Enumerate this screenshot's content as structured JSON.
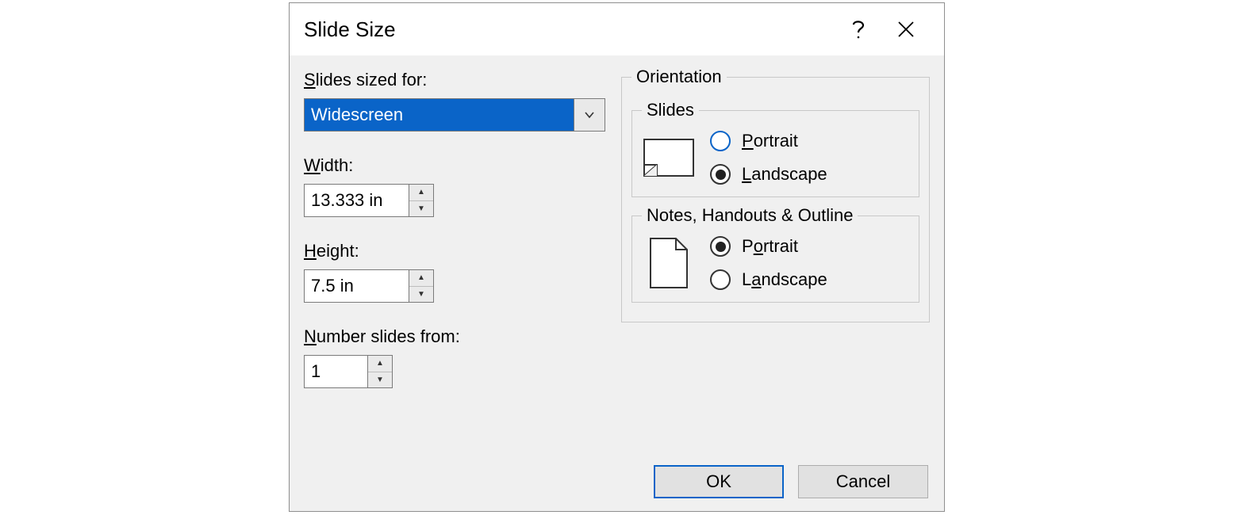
{
  "dialog": {
    "title": "Slide Size",
    "sized_for_label": "Slides sized for:",
    "sized_for_value": "Widescreen",
    "width_label": "Width:",
    "width_value": "13.333 in",
    "height_label": "Height:",
    "height_value": "7.5 in",
    "number_from_label": "Number slides from:",
    "number_from_value": "1",
    "orientation_legend": "Orientation",
    "slides_legend": "Slides",
    "notes_legend": "Notes, Handouts & Outline",
    "portrait_label": "Portrait",
    "landscape_label": "Landscape",
    "slides_orientation_selected": "landscape",
    "notes_orientation_selected": "portrait",
    "ok_label": "OK",
    "cancel_label": "Cancel"
  }
}
